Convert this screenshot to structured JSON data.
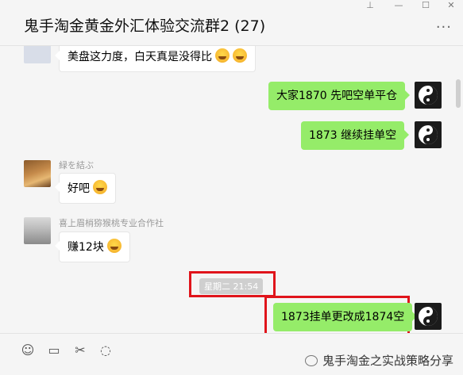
{
  "window": {
    "title": "鬼手淘金黄金外汇体验交流群2 (27)",
    "more_label": "···"
  },
  "messages": [
    {
      "text": "美盘这力度，白天真是没得比"
    },
    {
      "text": "大家1870  先吧空单平仓"
    },
    {
      "text": "1873  继续挂单空"
    },
    {
      "sender": "緑を結ぶ",
      "text": "好吧"
    },
    {
      "sender": "喜上眉梢猕猴桃专业合作社",
      "text": "赚12块"
    },
    {
      "text": "1873挂单更改成1874空"
    }
  ],
  "timestamp": "星期二 21:54",
  "watermark": "鬼手淘金之实战策略分享",
  "colors": {
    "bubble_self": "#95ec69",
    "bubble_other": "#ffffff",
    "highlight": "#e0141b"
  }
}
